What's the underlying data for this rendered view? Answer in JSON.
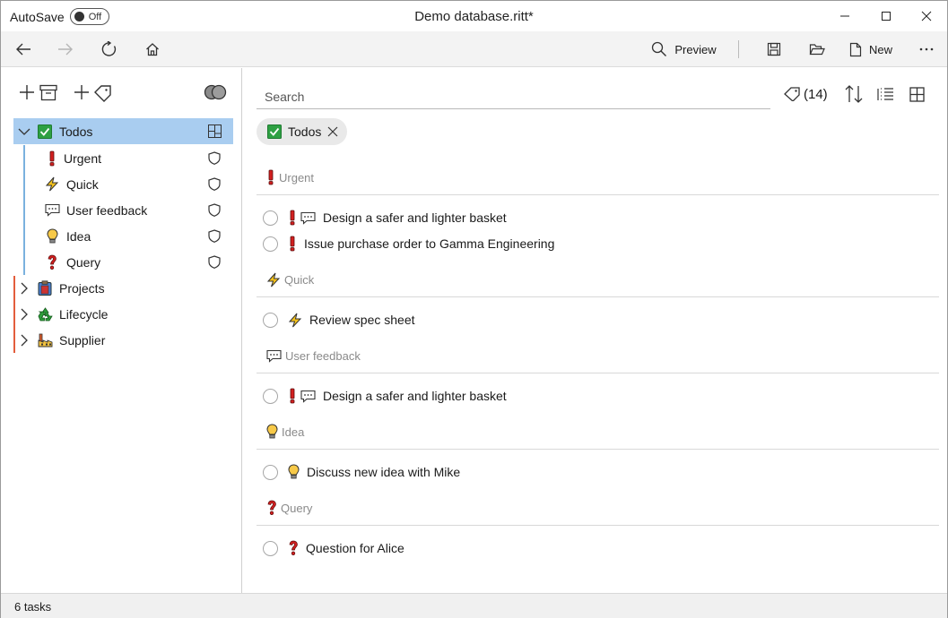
{
  "titlebar": {
    "autosave_label": "AutoSave",
    "autosave_state": "Off",
    "title": "Demo database.ritt*"
  },
  "toolbar": {
    "preview_label": "Preview",
    "new_label": "New"
  },
  "sidebar": {
    "root": {
      "label": "Todos",
      "icon": "check-box-icon"
    },
    "children": [
      {
        "label": "Urgent",
        "icon": "exclamation-icon"
      },
      {
        "label": "Quick",
        "icon": "lightning-icon"
      },
      {
        "label": "User feedback",
        "icon": "speech-bubble-icon"
      },
      {
        "label": "Idea",
        "icon": "lightbulb-icon"
      },
      {
        "label": "Query",
        "icon": "question-icon"
      }
    ],
    "others": [
      {
        "label": "Projects",
        "icon": "clipboard-icon"
      },
      {
        "label": "Lifecycle",
        "icon": "recycle-icon"
      },
      {
        "label": "Supplier",
        "icon": "factory-icon"
      }
    ]
  },
  "main": {
    "search_placeholder": "Search",
    "tag_count": "(14)",
    "filter_chip": "Todos",
    "groups": [
      {
        "label": "Urgent",
        "tasks": [
          "Design a safer and lighter basket",
          "Issue purchase order to Gamma Engineering"
        ]
      },
      {
        "label": "Quick",
        "tasks": [
          "Review spec sheet"
        ]
      },
      {
        "label": "User feedback",
        "tasks": [
          "Design a safer and lighter basket"
        ]
      },
      {
        "label": "Idea",
        "tasks": [
          "Discuss new idea with Mike"
        ]
      },
      {
        "label": "Query",
        "tasks": [
          "Question for Alice"
        ]
      }
    ]
  },
  "status": {
    "text": "6 tasks"
  },
  "colors": {
    "selection": "#a9cdf0",
    "red_bar": "#e35d3c",
    "blue_bar": "#7ab1de",
    "check_green": "#16a34a"
  }
}
